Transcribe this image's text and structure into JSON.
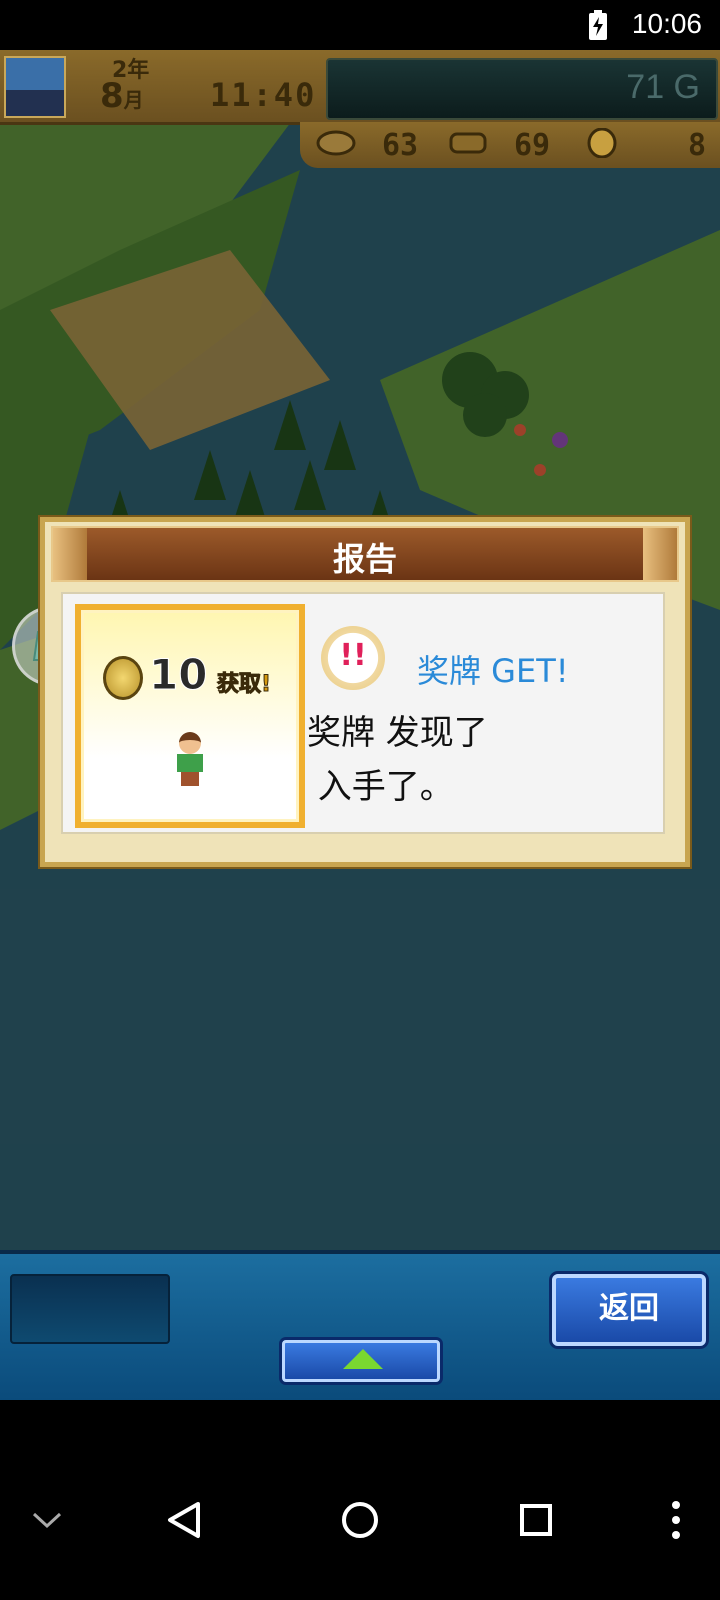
{
  "status_bar": {
    "time": "10:06",
    "battery_icon": "battery-charging-icon"
  },
  "hud": {
    "year": "2年",
    "month_number": "8",
    "month_unit": "月",
    "clock": "11:40",
    "money": "71 G",
    "resources": [
      {
        "icon": "food-icon",
        "value": "63"
      },
      {
        "icon": "wood-icon",
        "value": "69"
      },
      {
        "icon": "medal-coin-icon",
        "value": "8"
      }
    ]
  },
  "dialog": {
    "title": "报告",
    "reward_amount": "10",
    "reward_label": "获取!",
    "award_title": "奖牌 GET!",
    "message_lines": [
      "奖牌 发现了",
      " 入手了。"
    ]
  },
  "bottom_bar": {
    "back_label": "返回"
  },
  "nav_bar": {
    "icons": [
      "chevron-down-icon",
      "back-triangle-icon",
      "home-circle-icon",
      "recents-square-icon",
      "more-vert-icon"
    ]
  },
  "colors": {
    "award_text": "#2a8ad8",
    "header_wood": "#7a3e18",
    "card_border": "#f0b030",
    "button_blue": "#2a5ac8"
  }
}
